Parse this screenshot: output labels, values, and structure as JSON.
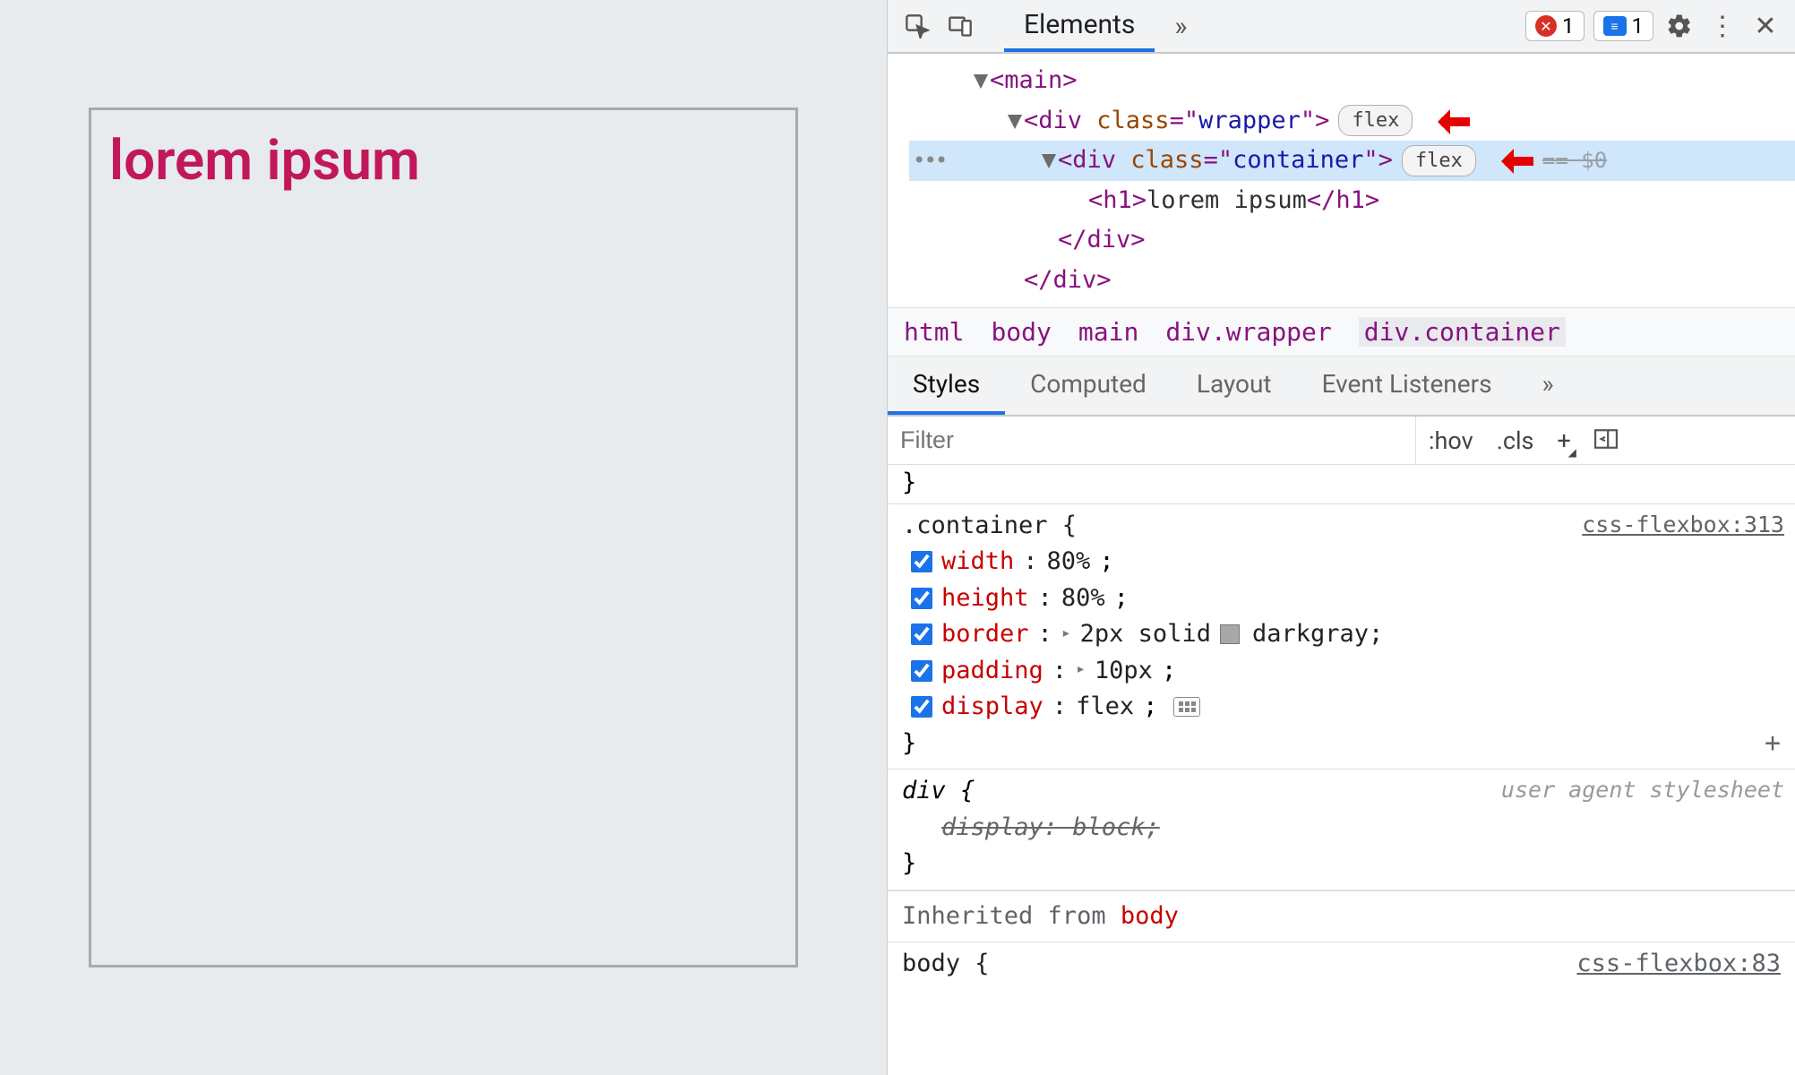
{
  "page": {
    "heading": "lorem ipsum"
  },
  "devtools": {
    "topTabs": {
      "active": "Elements",
      "moreGlyph": "»"
    },
    "badges": {
      "errors": "1",
      "messages": "1"
    },
    "elements": {
      "main": "<main>",
      "wrapper_open": "<div class=\"wrapper\">",
      "container_open": "<div class=\"container\">",
      "h1_open": "<h1>",
      "h1_text": "lorem ipsum",
      "h1_close": "</h1>",
      "div_close1": "</div>",
      "div_close2": "</div>",
      "flex_label": "flex",
      "dollarzero": "== $0"
    },
    "breadcrumb": {
      "items": [
        "html",
        "body",
        "main",
        "div.wrapper",
        "div.container"
      ]
    },
    "styleTabs": {
      "items": [
        "Styles",
        "Computed",
        "Layout",
        "Event Listeners"
      ],
      "more": "»"
    },
    "filter": {
      "placeholder": "Filter",
      "hov": ":hov",
      "cls": ".cls",
      "plus": "+"
    },
    "rules": {
      "container": {
        "selector": ".container {",
        "source": "css-flexbox:313",
        "decls": [
          {
            "prop": "width",
            "val": "80%",
            "expand": false,
            "swatch": false,
            "grid": false
          },
          {
            "prop": "height",
            "val": "80%",
            "expand": false,
            "swatch": false,
            "grid": false
          },
          {
            "prop": "border",
            "val": "2px solid ",
            "expand": true,
            "swatch": true,
            "swatch_color": "darkgray",
            "grid": false
          },
          {
            "prop": "padding",
            "val": "10px",
            "expand": true,
            "swatch": false,
            "grid": false
          },
          {
            "prop": "display",
            "val": "flex",
            "expand": false,
            "swatch": false,
            "grid": true
          }
        ],
        "close": "}"
      },
      "div_ua": {
        "selector": "div {",
        "source": "user agent stylesheet",
        "decl_struck": "display: block;",
        "close": "}"
      },
      "inherited": {
        "label": "Inherited from ",
        "from": "body"
      },
      "body_cut": {
        "selector": "body {",
        "source": "css-flexbox:83"
      }
    }
  }
}
